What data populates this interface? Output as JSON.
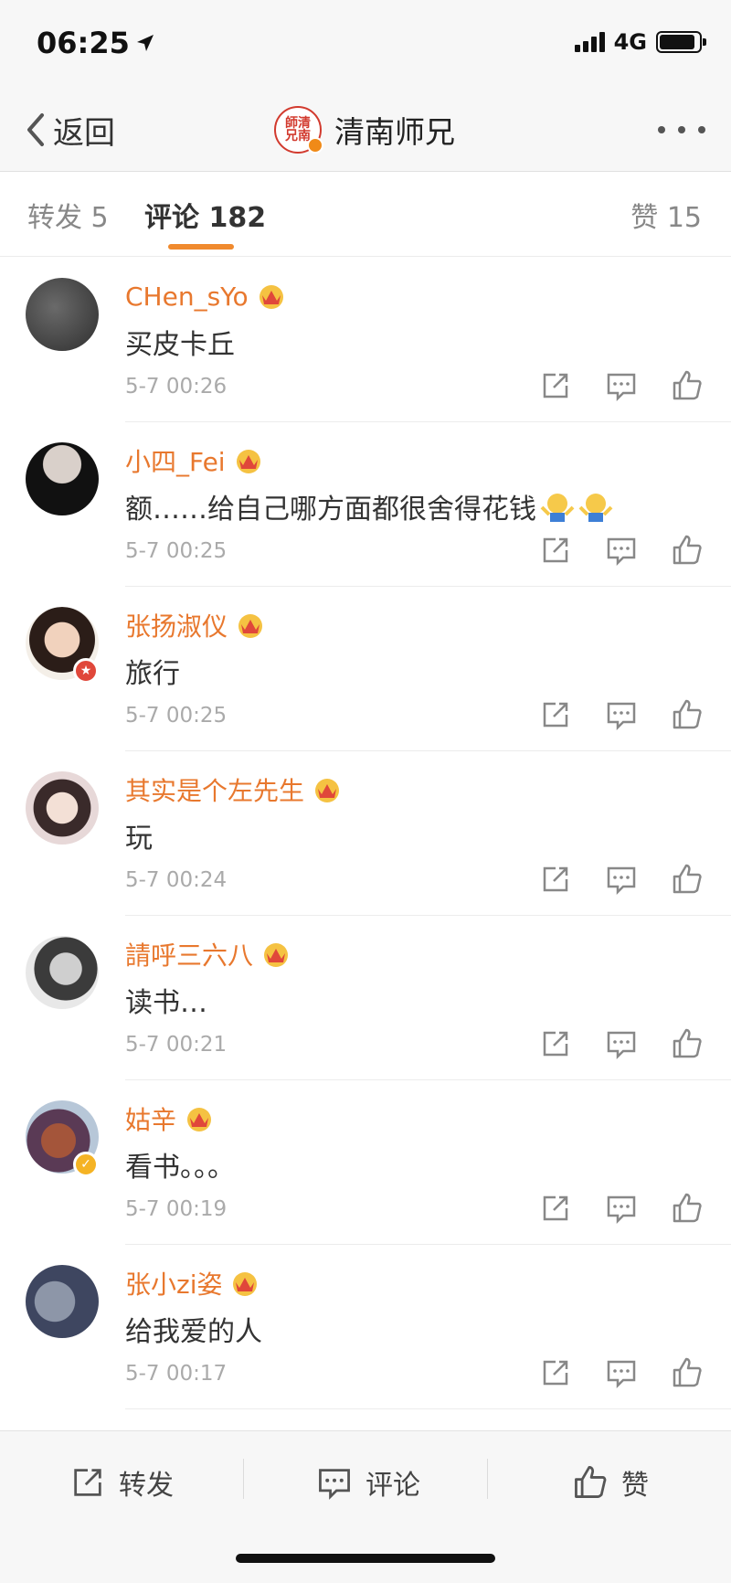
{
  "status_bar": {
    "time": "06:25",
    "network": "4G",
    "battery_level": 0.9,
    "signal_bars": 4
  },
  "nav": {
    "back_label": "返回",
    "title": "清南师兄",
    "avatar_text": "師清兄南",
    "more_icon": "ellipsis-icon"
  },
  "tabs": {
    "repost": "转发 5",
    "comment": "评论 182",
    "like": "赞 15",
    "active": "comment",
    "accent_color": "#f08a2e"
  },
  "comments": [
    {
      "user": "CHen_sYo",
      "text": "买皮卡丘",
      "time": "5-7 00:26",
      "emoji_count": 0,
      "badge": ""
    },
    {
      "user": "小四_Fei",
      "text": "额……给自己哪方面都很舍得花钱",
      "time": "5-7 00:25",
      "emoji_count": 2,
      "badge": ""
    },
    {
      "user": "张扬淑仪",
      "text": "旅行",
      "time": "5-7 00:25",
      "emoji_count": 0,
      "badge": "red-star"
    },
    {
      "user": "其实是个左先生",
      "text": "玩",
      "time": "5-7 00:24",
      "emoji_count": 0,
      "badge": ""
    },
    {
      "user": "請呼三六八",
      "text": "读书…",
      "time": "5-7 00:21",
      "emoji_count": 0,
      "badge": ""
    },
    {
      "user": "姑辛",
      "text": "看书。。。",
      "time": "5-7 00:19",
      "emoji_count": 0,
      "badge": "gold-v"
    },
    {
      "user": "张小zi姿",
      "text": "给我爱的人",
      "time": "5-7 00:17",
      "emoji_count": 0,
      "badge": ""
    }
  ],
  "toolbar": {
    "repost": "转发",
    "comment": "评论",
    "like": "赞"
  },
  "colors": {
    "username": "#e8782e",
    "text": "#333333",
    "time": "#aaaaaa",
    "bar_background": "#f7f7f7"
  }
}
